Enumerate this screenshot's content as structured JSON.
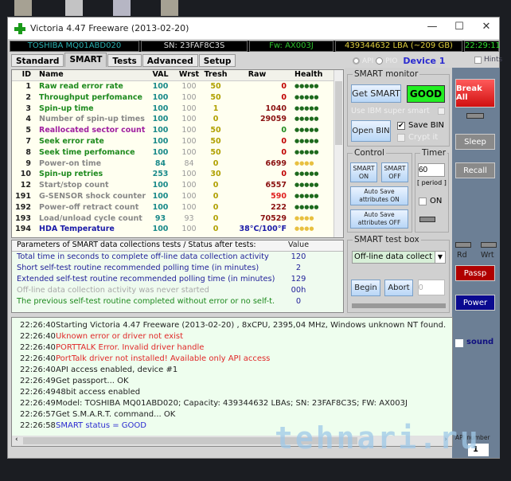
{
  "window": {
    "title": "Victoria 4.47  Freeware (2013-02-20)",
    "minimize": "—",
    "maximize": "☐",
    "close": "✕"
  },
  "info": {
    "model": "TOSHIBA MQ01ABD020",
    "sn": "SN: 23FAF8C3S",
    "fw": "Fw: AX003J",
    "lba": "439344632 LBA (~209 GB)",
    "clock": "22:29:11"
  },
  "tabs": [
    "Standard",
    "SMART",
    "Tests",
    "Advanced",
    "Setup"
  ],
  "mode": {
    "api": "API",
    "pio": "PIO",
    "device": "Device 1",
    "hints": "Hints"
  },
  "smart": {
    "headers": [
      "ID",
      "Name",
      "VAL",
      "Wrst",
      "Tresh",
      "Raw",
      "Health"
    ],
    "rows": [
      {
        "id": "1",
        "name": "Raw read error rate",
        "val": "100",
        "wrst": "100",
        "tresh": "50",
        "raw": "0",
        "health": "●●●●●",
        "color": "#1e8a1e",
        "raw_color": "#c00000"
      },
      {
        "id": "2",
        "name": "Throughput perfomance",
        "val": "100",
        "wrst": "100",
        "tresh": "50",
        "raw": "0",
        "health": "●●●●●",
        "color": "#1e8a1e",
        "raw_color": "#c00000"
      },
      {
        "id": "3",
        "name": "Spin-up time",
        "val": "100",
        "wrst": "100",
        "tresh": "1",
        "raw": "1040",
        "health": "●●●●●",
        "color": "#1e8a1e",
        "raw_color": "#8a1010"
      },
      {
        "id": "4",
        "name": "Number of spin-up times",
        "val": "100",
        "wrst": "100",
        "tresh": "0",
        "raw": "29059",
        "health": "●●●●●",
        "color": "#888888",
        "raw_color": "#8a1010"
      },
      {
        "id": "5",
        "name": "Reallocated sector count",
        "val": "100",
        "wrst": "100",
        "tresh": "50",
        "raw": "0",
        "health": "●●●●●",
        "color": "#a020a0",
        "raw_color": "#1e8a1e"
      },
      {
        "id": "7",
        "name": "Seek error rate",
        "val": "100",
        "wrst": "100",
        "tresh": "50",
        "raw": "0",
        "health": "●●●●●",
        "color": "#1e8a1e",
        "raw_color": "#c00000"
      },
      {
        "id": "8",
        "name": "Seek time perfomance",
        "val": "100",
        "wrst": "100",
        "tresh": "50",
        "raw": "0",
        "health": "●●●●●",
        "color": "#1e8a1e",
        "raw_color": "#c00000"
      },
      {
        "id": "9",
        "name": "Power-on time",
        "val": "84",
        "wrst": "84",
        "tresh": "0",
        "raw": "6699",
        "health": "●●●●",
        "color": "#888888",
        "raw_color": "#8a1010"
      },
      {
        "id": "10",
        "name": "Spin-up retries",
        "val": "253",
        "wrst": "100",
        "tresh": "30",
        "raw": "0",
        "health": "●●●●●",
        "color": "#1e8a1e",
        "raw_color": "#c00000"
      },
      {
        "id": "12",
        "name": "Start/stop count",
        "val": "100",
        "wrst": "100",
        "tresh": "0",
        "raw": "6557",
        "health": "●●●●●",
        "color": "#888888",
        "raw_color": "#8a1010"
      },
      {
        "id": "191",
        "name": "G-SENSOR shock counter",
        "val": "100",
        "wrst": "100",
        "tresh": "0",
        "raw": "590",
        "health": "●●●●●",
        "color": "#888888",
        "raw_color": "#e02020"
      },
      {
        "id": "192",
        "name": "Power-off retract count",
        "val": "100",
        "wrst": "100",
        "tresh": "0",
        "raw": "222",
        "health": "●●●●●",
        "color": "#888888",
        "raw_color": "#8a1010"
      },
      {
        "id": "193",
        "name": "Load/unload cycle count",
        "val": "93",
        "wrst": "93",
        "tresh": "0",
        "raw": "70529",
        "health": "●●●●",
        "color": "#888888",
        "raw_color": "#8a1010"
      },
      {
        "id": "194",
        "name": "HDA Temperature",
        "val": "100",
        "wrst": "100",
        "tresh": "0",
        "raw": "38°C/100°F",
        "health": "●●●●",
        "color": "#1a1aa8",
        "raw_color": "#1a1aa8"
      }
    ]
  },
  "params": {
    "header": "Parameters of SMART data collections tests / Status after tests:",
    "value_header": "Value",
    "rows": [
      {
        "text": "Total time in seconds to complete off-line data collection activity",
        "value": "120",
        "color": "#22229a"
      },
      {
        "text": "Short self-test routine recommended polling time (in minutes)",
        "value": "2",
        "color": "#22229a"
      },
      {
        "text": "Extended self-test routine recommended polling time (in minutes)",
        "value": "129",
        "color": "#22229a"
      },
      {
        "text": "Off-line data collection activity was never started",
        "value": "00h",
        "color": "#a8a8a8"
      },
      {
        "text": "The previous self-test routine completed without error or no self-t...",
        "value": "0",
        "color": "#1e8a1e"
      }
    ]
  },
  "smart_monitor": {
    "legend": "SMART monitor",
    "get_smart": "Get SMART",
    "status": "GOOD",
    "use_ibm": "Use IBM super smart",
    "open_bin": "Open BIN",
    "save_bin": "Save BIN",
    "crypt_it": "Crypt it"
  },
  "control": {
    "legend": "Control",
    "smart_on": "SMART ON",
    "smart_off": "SMART OFF",
    "auto_on": "Auto Save attributes ON",
    "auto_off": "Auto Save attributes OFF"
  },
  "timer": {
    "legend": "Timer",
    "value": "60",
    "period": "[ period ]",
    "on": "ON"
  },
  "test_box": {
    "legend": "SMART test box",
    "selected": "Off-line data collect",
    "begin": "Begin",
    "abort": "Abort",
    "value": "0"
  },
  "side": {
    "break_all": "Break All",
    "sleep": "Sleep",
    "recall": "Recall",
    "rd": "Rd",
    "wrt": "Wrt",
    "passp": "Passp",
    "power": "Power",
    "sound": "sound",
    "api_number_label": "API number",
    "api_number": "1"
  },
  "log": [
    {
      "time": "22:26:40",
      "msg": "Starting Victoria 4.47  Freeware (2013-02-20) , 8xCPU, 2395,04 MHz, Windows unknown NT found.",
      "color": "#222222"
    },
    {
      "time": "22:26:40",
      "msg": "Uknown error or driver not exist",
      "color": "#e02828"
    },
    {
      "time": "22:26:40",
      "msg": "PORTTALK Error. Invalid driver handle",
      "color": "#e02828"
    },
    {
      "time": "22:26:40",
      "msg": "PortTalk driver not installed! Available only API access",
      "color": "#e02828"
    },
    {
      "time": "22:26:40",
      "msg": "API access enabled, device #1",
      "color": "#222222"
    },
    {
      "time": "22:26:49",
      "msg": "Get passport... OK",
      "color": "#222222"
    },
    {
      "time": "22:26:49",
      "msg": "48bit access enabled",
      "color": "#222222"
    },
    {
      "time": "22:26:49",
      "msg": "Model: TOSHIBA MQ01ABD020; Capacity: 439344632 LBAs; SN: 23FAF8C3S; FW: AX003J",
      "color": "#222222"
    },
    {
      "time": "22:26:57",
      "msg": "Get S.M.A.R.T. command... OK",
      "color": "#222222"
    },
    {
      "time": "22:26:58",
      "msg": "SMART status = GOOD",
      "color": "#2a2ad0"
    }
  ],
  "watermark": "tehnari.ru"
}
